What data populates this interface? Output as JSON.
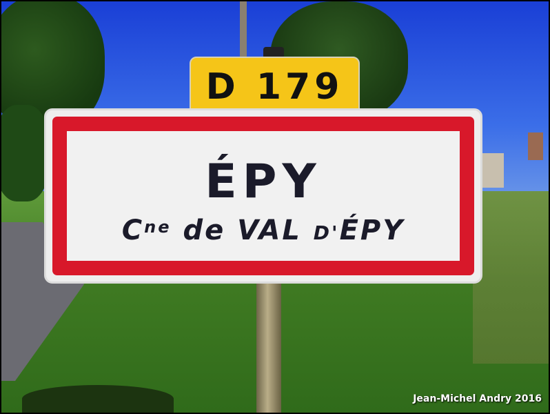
{
  "route_plate": {
    "text": "D 179",
    "color": "#f5c518"
  },
  "sign": {
    "town_name": "ÉPY",
    "commune_prefix": "C",
    "commune_prefix_sup": "ne",
    "commune_de": "de",
    "commune_val": "VAL",
    "commune_d": "D'",
    "commune_name": "ÉPY",
    "border_color": "#d8182a"
  },
  "credit": "Jean-Michel Andry 2016"
}
